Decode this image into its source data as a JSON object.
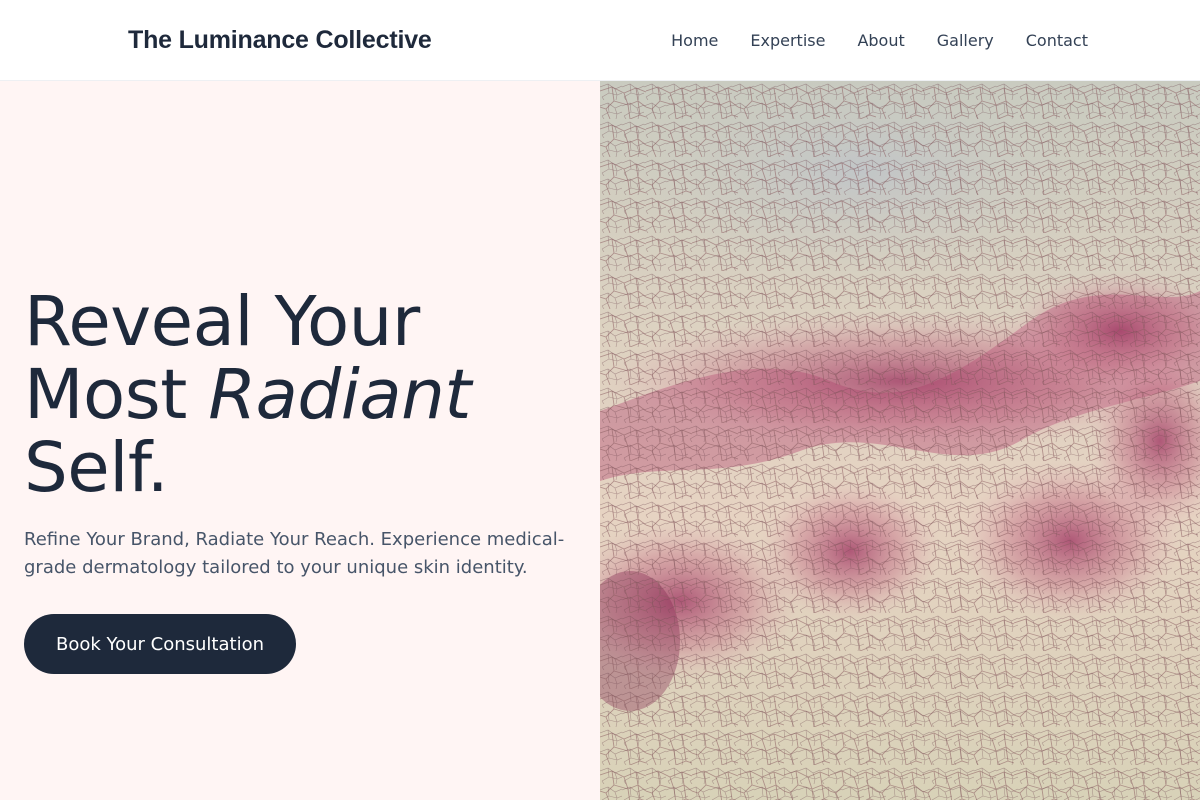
{
  "header": {
    "brand": "The Luminance Collective",
    "nav": [
      "Home",
      "Expertise",
      "About",
      "Gallery",
      "Contact"
    ]
  },
  "hero": {
    "headline_line1": "Reveal Your",
    "headline_line2_prefix": "Most ",
    "headline_line2_em": "Radiant",
    "headline_line3": "Self.",
    "subtext": "Refine Your Brand, Radiate Your Reach. Experience medical-grade dermatology tailored to your unique skin identity.",
    "cta_label": "Book Your Consultation"
  },
  "colors": {
    "dark_navy": "#1e293b",
    "hero_bg": "#fff5f4",
    "texture_pink": "#b04a72",
    "texture_cream": "#e4dcc8"
  },
  "image": {
    "semantic": "cracked-texture-image"
  }
}
